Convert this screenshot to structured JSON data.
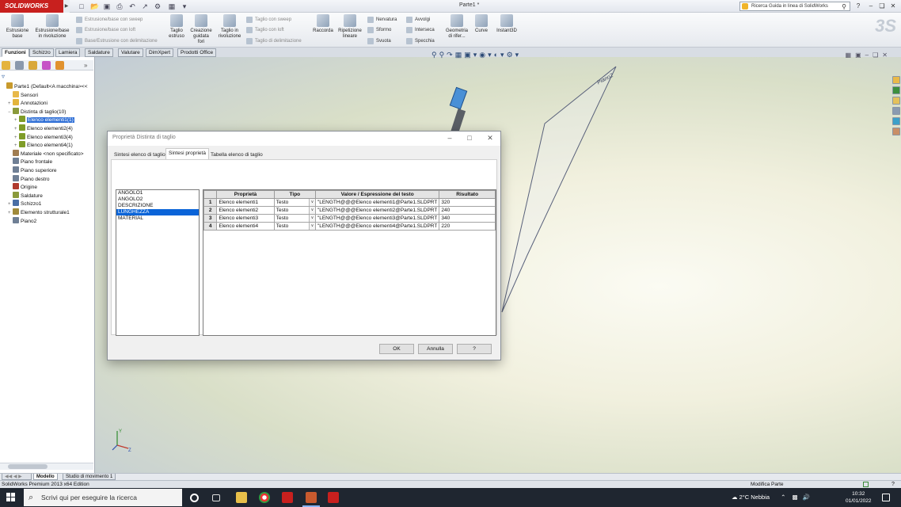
{
  "app": {
    "logo_text": "SOLIDWORKS",
    "doc_title": "Parte1 *",
    "search_placeholder": "Ricerca Guida in linea di SolidWorks"
  },
  "ribbon": {
    "big_buttons": [
      {
        "label": "Estrusione\nbase",
        "enabled": true
      },
      {
        "label": "Estrusione/base\nin rivoluzione",
        "enabled": true
      },
      {
        "label": "Taglio\nestruso",
        "enabled": true
      },
      {
        "label": "Creazione\nguidata\nfori",
        "enabled": true
      },
      {
        "label": "Taglio in\nrivoluzione",
        "enabled": true
      },
      {
        "label": "Raccorda",
        "enabled": true
      },
      {
        "label": "Ripetizione\nlineare",
        "enabled": true
      },
      {
        "label": "Geometria\ndi rifer...",
        "enabled": true
      },
      {
        "label": "Curve",
        "enabled": true
      },
      {
        "label": "Instant3D",
        "enabled": true
      }
    ],
    "small_buttons": [
      {
        "label": "Estrusione/base con sweep",
        "enabled": false
      },
      {
        "label": "Estrusione/base con loft",
        "enabled": false
      },
      {
        "label": "Base/Estrusione con delimitazione",
        "enabled": false
      },
      {
        "label": "Taglio con sweep",
        "enabled": false
      },
      {
        "label": "Taglio con loft",
        "enabled": false
      },
      {
        "label": "Taglio di delimitazione",
        "enabled": false
      },
      {
        "label": "Nervatura",
        "enabled": true
      },
      {
        "label": "Sformo",
        "enabled": true
      },
      {
        "label": "Svuota",
        "enabled": true
      },
      {
        "label": "Avvolgi",
        "enabled": true
      },
      {
        "label": "Interseca",
        "enabled": true
      },
      {
        "label": "Specchia",
        "enabled": true
      }
    ]
  },
  "command_tabs": [
    "Funzioni",
    "Schizzo",
    "Lamiera",
    "Saldature",
    "Valutare",
    "DimXpert",
    "Prodotti Office"
  ],
  "command_tab_active": 0,
  "feature_tree": [
    {
      "label": "Parte1  (Default<A macchina><<",
      "icon": "part-icon",
      "color": "#c89a2c"
    },
    {
      "label": "Sensori",
      "icon": "sensor-icon",
      "color": "#e7b84a"
    },
    {
      "label": "Annotazioni",
      "icon": "annotation-icon",
      "color": "#e3b43b"
    },
    {
      "label": "Distinta di taglio(10)",
      "icon": "cut-list-icon",
      "color": "#8a9a3b"
    },
    {
      "label": "Elenco elementi1(1)",
      "icon": "cut-item-icon",
      "color": "#7f9c28",
      "selected": true
    },
    {
      "label": "Elenco elementi2(4)",
      "icon": "cut-item-icon",
      "color": "#7f9c28"
    },
    {
      "label": "Elenco elementi3(4)",
      "icon": "cut-item-icon",
      "color": "#7f9c28"
    },
    {
      "label": "Elenco elementi4(1)",
      "icon": "cut-item-icon",
      "color": "#7f9c28"
    },
    {
      "label": "Materiale <non specificato>",
      "icon": "material-icon",
      "color": "#a07d52"
    },
    {
      "label": "Piano frontale",
      "icon": "plane-icon",
      "color": "#6f7f95"
    },
    {
      "label": "Piano superiore",
      "icon": "plane-icon",
      "color": "#6f7f95"
    },
    {
      "label": "Piano destro",
      "icon": "plane-icon",
      "color": "#6f7f95"
    },
    {
      "label": "Origine",
      "icon": "origin-icon",
      "color": "#b03a2e"
    },
    {
      "label": "Saldature",
      "icon": "weldment-icon",
      "color": "#8a9a3b"
    },
    {
      "label": "Schizzo1",
      "icon": "sketch-icon",
      "color": "#4a6fa5"
    },
    {
      "label": "Elemento strutturale1",
      "icon": "structural-member-icon",
      "color": "#a08a3b"
    },
    {
      "label": "Piano2",
      "icon": "plane-icon",
      "color": "#6f7f95"
    }
  ],
  "dialog": {
    "title": "Proprietà Distinta di taglio",
    "tabs": [
      "Sintesi elenco di taglio",
      "Sintesi proprietà",
      "Tabella elenco di taglio"
    ],
    "active_tab": 1,
    "property_list": [
      "ANGOLO1",
      "ANGOLO2",
      "DESCRIZIONE",
      "LUNGHEZZA",
      "MATERIAL"
    ],
    "property_list_selected": 3,
    "columns": [
      "Proprietà",
      "Tipo",
      "Valore / Espressione del testo",
      "Risultato"
    ],
    "rows": [
      {
        "n": "1",
        "prop": "Elenco elementi1",
        "tipo": "Testo",
        "valore": "\"LENGTH@@@Elenco elementi1@Parte1.SLDPRT",
        "risultato": "320"
      },
      {
        "n": "2",
        "prop": "Elenco elementi2",
        "tipo": "Testo",
        "valore": "\"LENGTH@@@Elenco elementi2@Parte1.SLDPRT",
        "risultato": "240"
      },
      {
        "n": "3",
        "prop": "Elenco elementi3",
        "tipo": "Testo",
        "valore": "\"LENGTH@@@Elenco elementi3@Parte1.SLDPRT",
        "risultato": "340"
      },
      {
        "n": "4",
        "prop": "Elenco elementi4",
        "tipo": "Testo",
        "valore": "\"LENGTH@@@Elenco elementi4@Parte1.SLDPRT",
        "risultato": "220"
      }
    ],
    "buttons": {
      "ok": "OK",
      "cancel": "Annulla",
      "help": "?"
    }
  },
  "viewport": {
    "plane_label": "Piano2"
  },
  "model_tabs": [
    "Modello",
    "Studio di movimento 1"
  ],
  "status": {
    "left": "SolidWorks Premium 2013 x64 Edition",
    "right": "Modifica Parte"
  },
  "taskbar": {
    "search_placeholder": "Scrivi qui per eseguire la ricerca",
    "weather": "2°C  Nebbia",
    "time": "10:32",
    "date": "01/01/2022"
  },
  "colors": {
    "brand": "#c8201e",
    "selection": "#0a64d8"
  }
}
